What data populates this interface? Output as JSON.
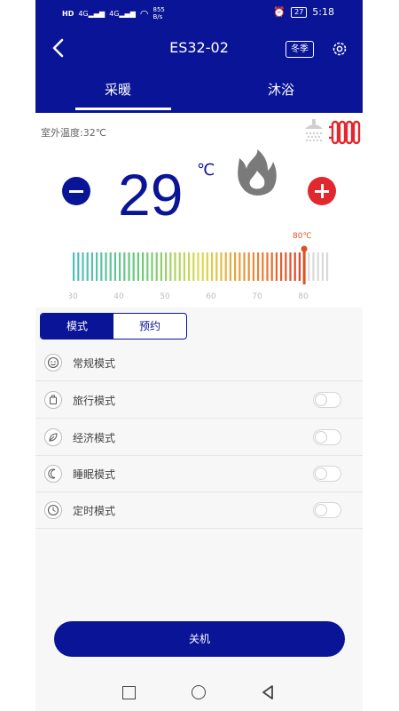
{
  "status_bar": {
    "network_speed": "855",
    "network_speed_unit": "B/s",
    "signal_1": "4G",
    "signal_2": "4G",
    "battery": "27",
    "time": "5:18"
  },
  "header": {
    "title": "ES32-02",
    "season_button": "冬季"
  },
  "tabs": [
    {
      "label": "采暖",
      "active": true
    },
    {
      "label": "沐浴",
      "active": false
    }
  ],
  "heating": {
    "outdoor_temp": "室外温度:32℃",
    "setpoint": "29",
    "unit": "℃",
    "scale_marker": "80℃",
    "scale_labels": [
      "30",
      "40",
      "50",
      "60",
      "70",
      "80"
    ],
    "scale_min": 30,
    "scale_max": 85,
    "scale_current": 80
  },
  "segment": {
    "mode_label": "模式",
    "schedule_label": "预约"
  },
  "modes": [
    {
      "label": "常规模式",
      "icon": "smile-icon",
      "has_toggle": false,
      "enabled": true
    },
    {
      "label": "旅行模式",
      "icon": "luggage-icon",
      "has_toggle": true,
      "enabled": false
    },
    {
      "label": "经济模式",
      "icon": "leaf-icon",
      "has_toggle": true,
      "enabled": false
    },
    {
      "label": "睡眠模式",
      "icon": "moon-icon",
      "has_toggle": true,
      "enabled": false
    },
    {
      "label": "定时模式",
      "icon": "clock-icon",
      "has_toggle": true,
      "enabled": false
    }
  ],
  "power_button": "关机",
  "colors": {
    "primary": "#0a1496",
    "accent_red": "#e0282e"
  }
}
